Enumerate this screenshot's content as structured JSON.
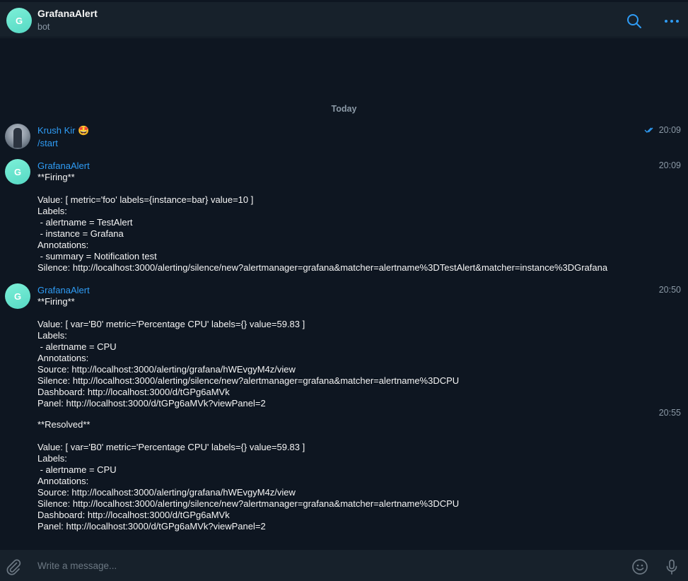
{
  "header": {
    "avatar_letter": "G",
    "title": "GrafanaAlert",
    "subtitle": "bot"
  },
  "chat": {
    "date_separator": "Today",
    "messages": [
      {
        "sender": "Krush Kir 🤩",
        "time": "20:09",
        "read": true,
        "text": "/start"
      },
      {
        "sender": "GrafanaAlert",
        "avatar_letter": "G",
        "time": "20:09",
        "text": "**Firing**\n\nValue: [ metric='foo' labels={instance=bar} value=10 ]\nLabels:\n - alertname = TestAlert\n - instance = Grafana\nAnnotations:\n - summary = Notification test\nSilence: http://localhost:3000/alerting/silence/new?alertmanager=grafana&matcher=alertname%3DTestAlert&matcher=instance%3DGrafana"
      },
      {
        "sender": "GrafanaAlert",
        "avatar_letter": "G",
        "time": "20:50",
        "text": "**Firing**\n\nValue: [ var='B0' metric='Percentage CPU' labels={} value=59.83 ]\nLabels:\n - alertname = CPU\nAnnotations:\nSource: http://localhost:3000/alerting/grafana/hWEvgyM4z/view\nSilence: http://localhost:3000/alerting/silence/new?alertmanager=grafana&matcher=alertname%3DCPU\nDashboard: http://localhost:3000/d/tGPg6aMVk\nPanel: http://localhost:3000/d/tGPg6aMVk?viewPanel=2"
      },
      {
        "time": "20:55",
        "text": "**Resolved**\n\nValue: [ var='B0' metric='Percentage CPU' labels={} value=59.83 ]\nLabels:\n - alertname = CPU\nAnnotations:\nSource: http://localhost:3000/alerting/grafana/hWEvgyM4z/view\nSilence: http://localhost:3000/alerting/silence/new?alertmanager=grafana&matcher=alertname%3DCPU\nDashboard: http://localhost:3000/d/tGPg6aMVk\nPanel: http://localhost:3000/d/tGPg6aMVk?viewPanel=2"
      }
    ]
  },
  "composer": {
    "placeholder": "Write a message..."
  },
  "icons": {
    "search": "search-icon",
    "more": "more-icon",
    "attach": "paperclip-icon",
    "emoji": "emoji-icon",
    "voice": "microphone-icon",
    "read_receipt": "double-check-icon"
  },
  "colors": {
    "accent": "#2f9cf5",
    "avatar": "#64e3cd",
    "background": "#0e1621",
    "panel": "#17212b"
  }
}
